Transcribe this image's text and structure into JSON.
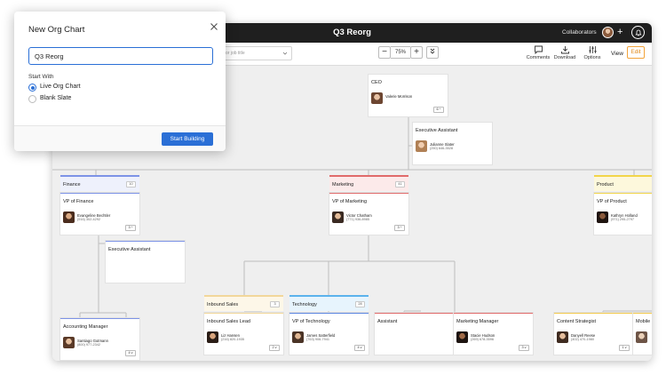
{
  "titlebar": {
    "title": "Q3 Reorg",
    "collaborators_label": "Collaborators",
    "add_symbol": "+"
  },
  "toolbar": {
    "search_placeholder": "or job title",
    "zoom_out": "−",
    "zoom_level": "75%",
    "zoom_in": "+",
    "comments": "Comments",
    "download": "Download",
    "options": "Options",
    "view": "View",
    "edit": "Edit"
  },
  "colors": {
    "accent": "#2a6fd6",
    "edit": "#f2a33a",
    "finance": "#7d93e6",
    "marketing": "#e06b6b",
    "product": "#f2d54a",
    "inbound": "#f2d79a",
    "technology": "#5bb2ec",
    "tech_card": "#5b86e0",
    "strategist": "#f2c94c"
  },
  "chart": {
    "ceo": {
      "role": "CEO",
      "name": "Valerie Morrison",
      "count": "6 ^"
    },
    "exec_assistant_top": {
      "role": "Executive Assistant",
      "name": "Julianne Slater",
      "phone": "(250) 646-3528"
    },
    "finance": {
      "dept": "Finance",
      "count": "10",
      "vp_role": "VP of Finance",
      "vp_name": "Evangeline Bechtler",
      "vp_phone": "(916) 302-4292",
      "vp_count": "3 ^",
      "assistant_role": "Executive Assistant"
    },
    "accounting": {
      "role": "Accounting Manager",
      "name": "Santiago Gutmann",
      "phone": "(800) 977-2342",
      "count": "4 v"
    },
    "marketing": {
      "dept": "Marketing",
      "count": "41",
      "vp_role": "VP of Marketing",
      "vp_name": "Victor Chatham",
      "vp_phone": "(771) 936-8985",
      "vp_count": "3 ^"
    },
    "product": {
      "dept": "Product",
      "vp_role": "VP of Product",
      "vp_name": "Kathryn Holland",
      "vp_phone": "(971) 295-2797"
    },
    "inbound": {
      "dept": "Inbound Sales",
      "count": "3",
      "lead_role": "Inbound Sales Lead",
      "lead_name": "Liz Hansen",
      "lead_phone": "(216) 820-1935",
      "lead_count": "2 v"
    },
    "technology": {
      "dept": "Technology",
      "count": "28",
      "vp_role": "VP of Technology",
      "vp_name": "James Satterfield",
      "vp_phone": "(763) 906-7941",
      "vp_count": "4 v"
    },
    "assistant_partial": {
      "role": "Assistant"
    },
    "marketing_manager": {
      "role": "Marketing Manager",
      "name": "Stacie Hudson",
      "phone": "(269) 678-3596",
      "count": "3 v"
    },
    "content_strategist": {
      "role": "Content Strategist",
      "name": "Danyell Reese",
      "phone": "(402) 470-1980",
      "count": "1 v"
    },
    "mobile_partial": {
      "role": "Mobile"
    }
  },
  "dialog": {
    "title": "New Org Chart",
    "input_value": "Q3 Reorg",
    "start_with": "Start With",
    "option_live": "Live Org Chart",
    "option_blank": "Blank Slate",
    "button": "Start Building"
  }
}
